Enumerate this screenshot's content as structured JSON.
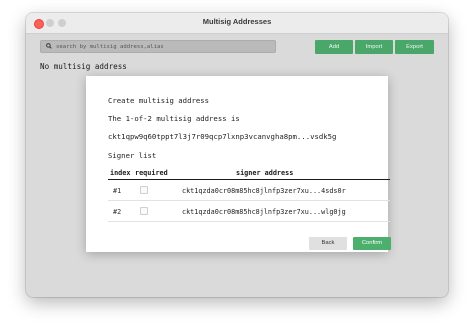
{
  "window": {
    "title": "Multisig Addresses"
  },
  "toolbar": {
    "search_placeholder": "search by multisig address,alias",
    "add_label": "Add",
    "import_label": "Import",
    "export_label": "Export"
  },
  "main": {
    "empty_message": "No multisig address"
  },
  "dialog": {
    "title": "Create multisig address",
    "policy": "The 1-of-2 multisig address is",
    "multisig_address": "ckt1qpw9q60tppt7l3j7r09qcp7lxnp3vcanvgha8pm...vsdk5g",
    "signer_list_title": "Signer list",
    "columns": {
      "index": "index",
      "required": "required",
      "address": "signer address"
    },
    "signers": [
      {
        "index": "#1",
        "required": false,
        "address": "ckt1qzda0cr08m85hc8jlnfp3zer7xu...4sds0r"
      },
      {
        "index": "#2",
        "required": false,
        "address": "ckt1qzda0cr08m85hc8jlnfp3zer7xu...wlg0jg"
      }
    ],
    "back_label": "Back",
    "confirm_label": "Confirm"
  },
  "colors": {
    "accent": "#4caf6e",
    "close": "#fe5f57"
  }
}
